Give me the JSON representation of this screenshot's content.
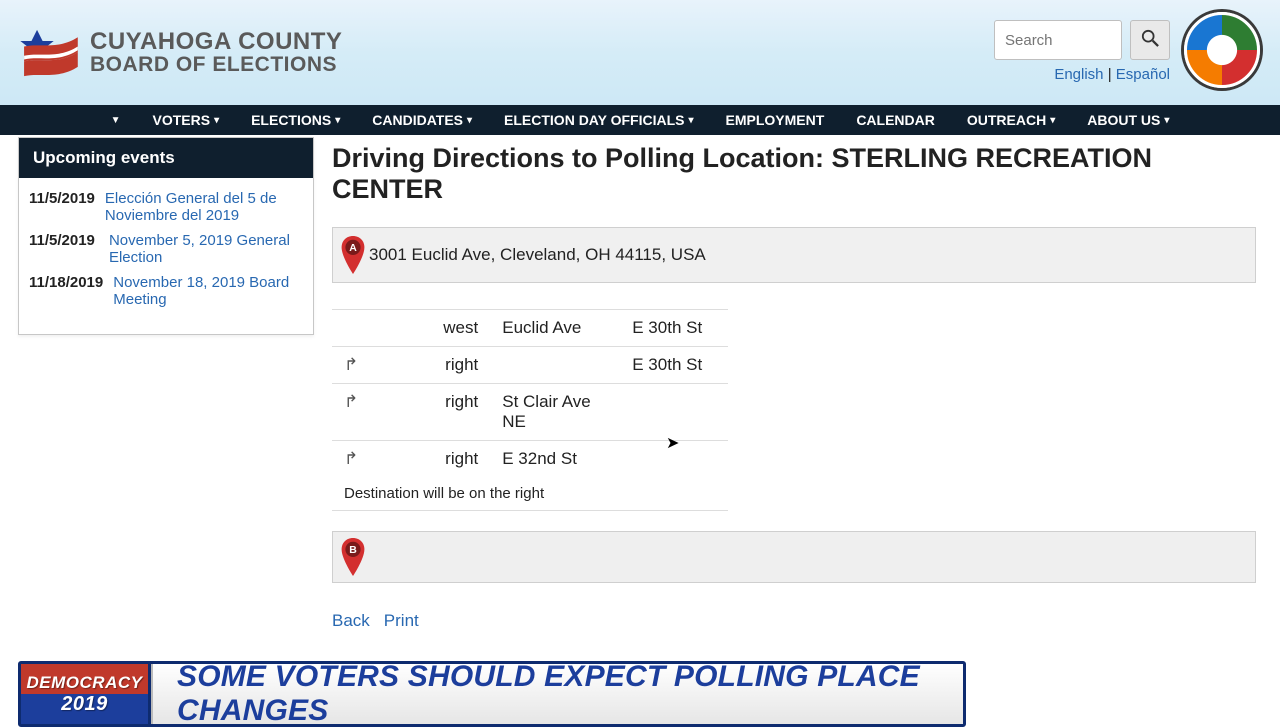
{
  "header": {
    "site_title_l1": "CUYAHOGA COUNTY",
    "site_title_l2": "BOARD OF ELECTIONS",
    "search_placeholder": "Search",
    "lang_en": "English",
    "lang_es": "Español"
  },
  "nav": {
    "items": [
      "VOTERS",
      "ELECTIONS",
      "CANDIDATES",
      "ELECTION DAY OFFICIALS",
      "EMPLOYMENT",
      "CALENDAR",
      "OUTREACH",
      "ABOUT US"
    ]
  },
  "sidebar": {
    "heading": "Upcoming events",
    "events": [
      {
        "date": "11/5/2019",
        "title": "Elección General del 5 de Noviembre del 2019"
      },
      {
        "date": "11/5/2019",
        "title": "November 5, 2019 General Election"
      },
      {
        "date": "11/18/2019",
        "title": "November 18, 2019 Board Meeting"
      }
    ]
  },
  "main": {
    "title_prefix": "Driving Directions to Polling Location: ",
    "location_name": "STERLING RECREATION CENTER",
    "origin_address": "3001 Euclid Ave, Cleveland, OH 44115, USA",
    "steps": [
      {
        "icon": "",
        "maneuver": "west",
        "road1": "Euclid Ave",
        "road2": "E 30th St"
      },
      {
        "icon": "↱",
        "maneuver": "right",
        "road1": "",
        "road2": "E 30th St"
      },
      {
        "icon": "↱",
        "maneuver": "right",
        "road1": "St Clair Ave NE",
        "road2": ""
      },
      {
        "icon": "↱",
        "maneuver": "right",
        "road1": "E 32nd St",
        "road2": ""
      }
    ],
    "destination_note": "Destination will be on the right",
    "pin_a": "A",
    "pin_b": "B",
    "links": {
      "back": "Back",
      "print": "Print"
    }
  },
  "chyron": {
    "brand_top": "DEMOCRACY",
    "brand_year": "2019",
    "headline": "SOME VOTERS SHOULD EXPECT POLLING PLACE CHANGES"
  }
}
